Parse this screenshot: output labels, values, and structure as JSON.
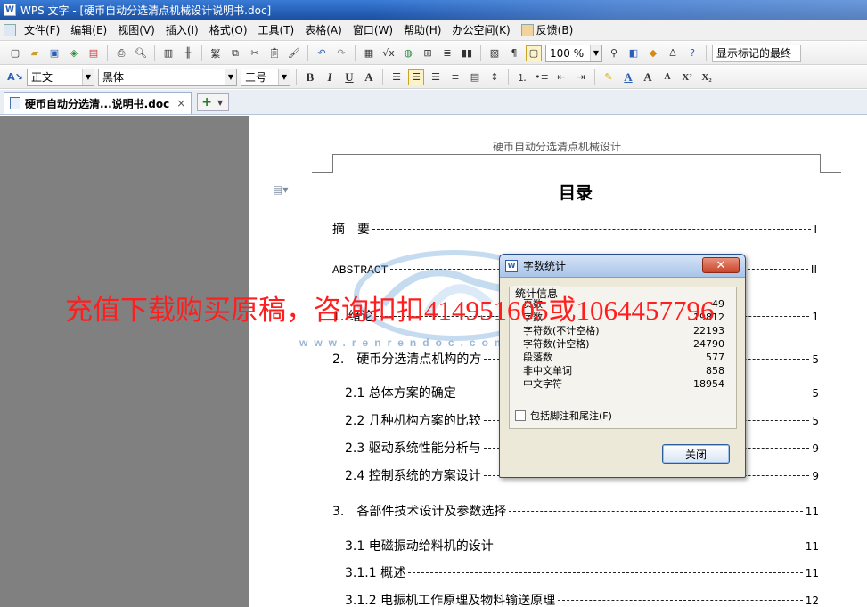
{
  "window": {
    "title": "WPS 文字 - [硬币自动分选清点机械设计说明书.doc]",
    "app_badge": "W"
  },
  "menubar": {
    "items": [
      "文件(F)",
      "编辑(E)",
      "视图(V)",
      "插入(I)",
      "格式(O)",
      "工具(T)",
      "表格(A)",
      "窗口(W)",
      "帮助(H)",
      "办公空间(K)",
      "反馈(B)"
    ]
  },
  "toolbar": {
    "zoom": "100 %",
    "markup_view": "显示标记的最终",
    "style": "正文",
    "font": "黑体",
    "size": "三号",
    "bold": "B",
    "italic": "I",
    "underline": "U",
    "char_a": "A",
    "sup": "X²",
    "sub": "X₂"
  },
  "tabs": {
    "doc_tab": "硬币自动分选清...说明书.doc",
    "close": "×",
    "new_tab": "+"
  },
  "document": {
    "header": "硬币自动分选清点机械设计",
    "toc_title": "目录",
    "toc": [
      {
        "text": "摘　要",
        "page": "I"
      },
      {
        "text": "ABSTRACT",
        "page": "II"
      },
      {
        "text": "1. 绪论",
        "page": "1"
      },
      {
        "text": "2.　硬币分选清点机构的方",
        "page": "5"
      },
      {
        "text": "2.1 总体方案的确定",
        "page": "5"
      },
      {
        "text": "2.2 几种机构方案的比较",
        "page": "5"
      },
      {
        "text": "2.3 驱动系统性能分析与",
        "page": "9"
      },
      {
        "text": "2.4 控制系统的方案设计",
        "page": "9"
      },
      {
        "text": "3.　各部件技术设计及参数选择",
        "page": "11"
      },
      {
        "text": "3.1 电磁振动给料机的设计",
        "page": "11"
      },
      {
        "text": "3.1.1 概述",
        "page": "11"
      },
      {
        "text": "3.1.2 电振机工作原理及物料输送原理",
        "page": "12"
      }
    ]
  },
  "watermark": {
    "url": "www.renrendoc.com",
    "promo": "充值下载购买原稿，咨询扣扣414951605或1064457796"
  },
  "dialog": {
    "title": "字数统计",
    "legend": "统计信息",
    "stats": [
      {
        "label": "页数",
        "value": "49"
      },
      {
        "label": "字数",
        "value": "19812"
      },
      {
        "label": "字符数(不计空格)",
        "value": "22193"
      },
      {
        "label": "字符数(计空格)",
        "value": "24790"
      },
      {
        "label": "段落数",
        "value": "577"
      },
      {
        "label": "非中文单词",
        "value": "858"
      },
      {
        "label": "中文字符",
        "value": "18954"
      }
    ],
    "checkbox_label": "包括脚注和尾注(F)",
    "checkbox_checked": false,
    "close_label": "关闭",
    "close_x": "✕"
  },
  "colors": {
    "titlebar": "#2560b8",
    "watermark_red": "#ff1e1e",
    "workspace_gray": "#808080",
    "dialog_bg": "#ece9d8"
  }
}
